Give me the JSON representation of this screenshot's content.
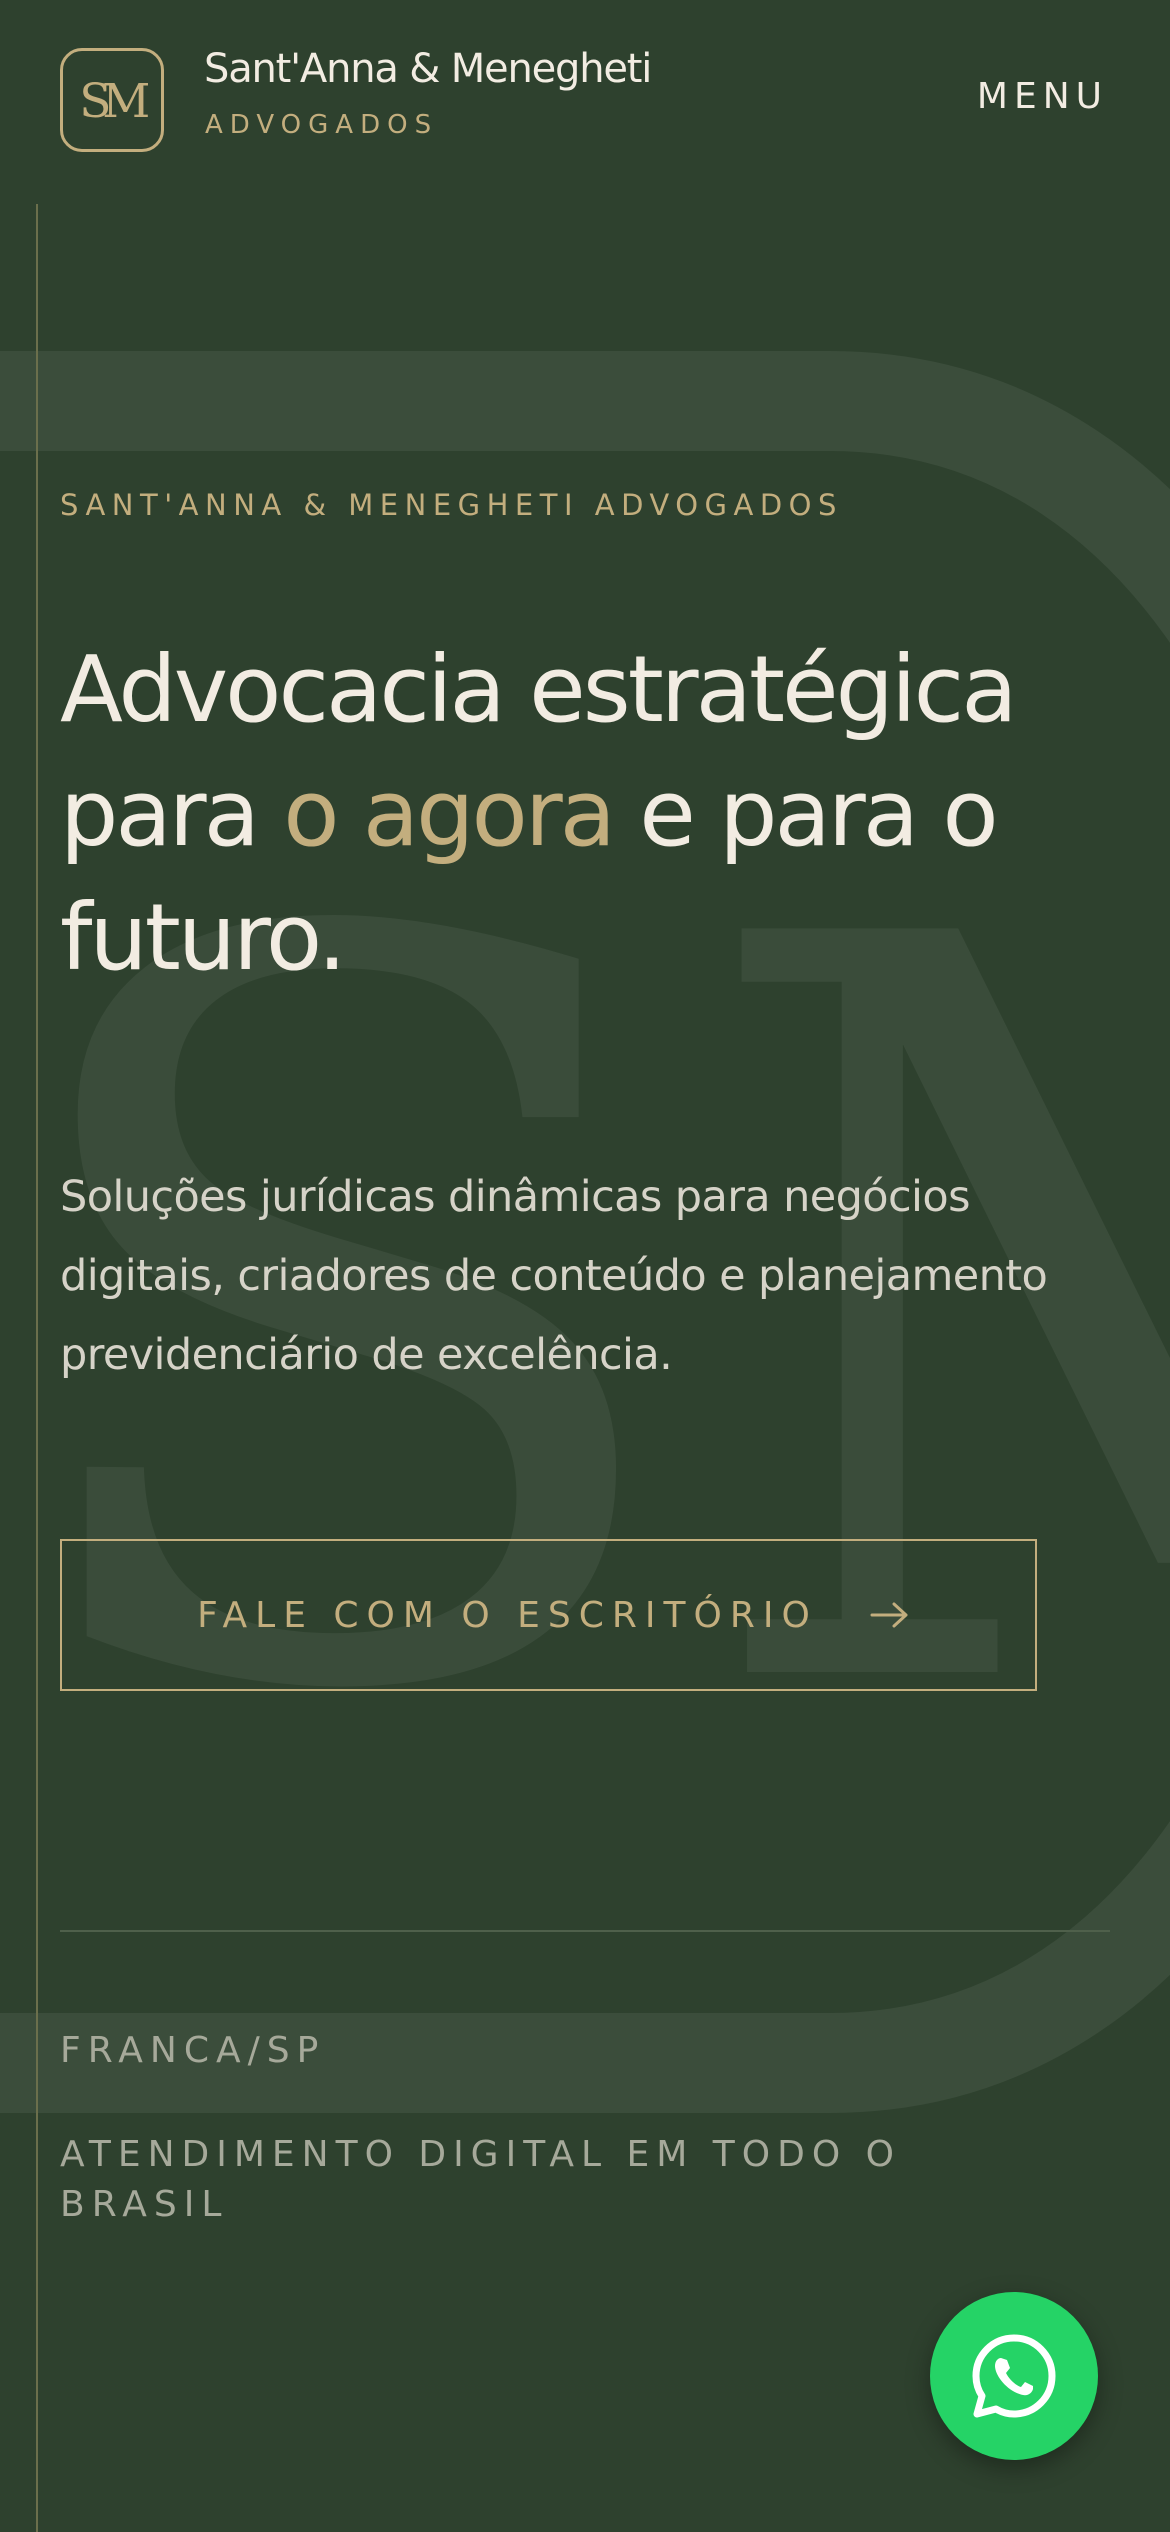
{
  "header": {
    "logo_monogram": "SM",
    "brand_name": "Sant'Anna & Menegheti",
    "brand_sub": "ADVOGADOS",
    "menu_label": "MENU"
  },
  "hero": {
    "watermark_monogram": "SM",
    "eyebrow": "SANT'ANNA & MENEGHETI ADVOGADOS",
    "headline_part1": "Advocacia estratégica para ",
    "headline_accent": "o agora",
    "headline_part2": " e para o futuro.",
    "lead": "Soluções jurídicas dinâmicas para negócios digitais, criadores de conteúdo e planejamento previdenciário de excelência.",
    "cta_label": "FALE COM O ESCRITÓRIO",
    "cta_icon": "arrow-right-icon"
  },
  "footer_info": {
    "location": "FRANCA/SP",
    "service_area": "ATENDIMENTO DIGITAL EM TODO O BRASIL"
  },
  "floating": {
    "whatsapp_icon": "whatsapp-icon"
  },
  "colors": {
    "background": "#2e412e",
    "gold": "#c3ae7e",
    "cream": "#f2ece2",
    "muted_text": "#a6a99a",
    "whatsapp_green": "#25d366"
  }
}
